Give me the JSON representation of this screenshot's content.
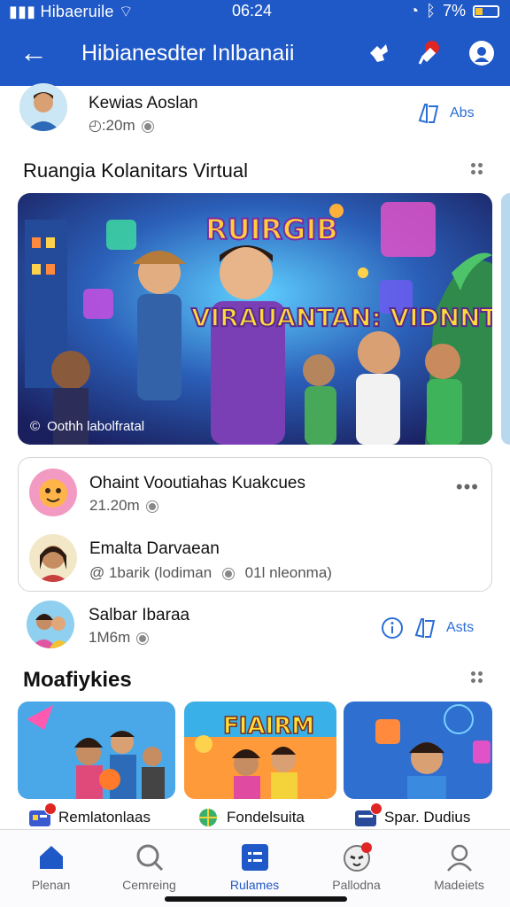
{
  "status": {
    "carrier": "Hibaeruile",
    "time": "06:24",
    "battery": "7%"
  },
  "header": {
    "title": "Hibianesdter Inlbanaii"
  },
  "colors": {
    "brand": "#1f58c7",
    "accent": "#2c6ed6",
    "badge": "#e02525"
  },
  "top_row": {
    "name": "Kewias Aoslan",
    "meta": "◴:20m",
    "action": "Abs"
  },
  "section1": {
    "title": "Ruangia Kolanitars Virtual"
  },
  "banner": {
    "headline_top": "RUIRGIB",
    "headline": "VIRAUANTAN: VIDNNTAS!",
    "caption": "Oothh labolfratal"
  },
  "card": {
    "items": [
      {
        "name": "Ohaint Vooutiahas Kuakcues",
        "meta": "21.20m"
      },
      {
        "name": "Emalta Darvaean",
        "meta_prefix": "@ 1barik (lodiman",
        "meta_suffix": "01l nleonma)"
      }
    ]
  },
  "row3": {
    "name": "Salbar Ibaraa",
    "meta": "1M6m",
    "action": "Asts"
  },
  "section2": {
    "title": "Moafiykies"
  },
  "thumbs": [
    {
      "label": "Remlatonlaas",
      "banner_text": ""
    },
    {
      "label": "Fondelsuita",
      "banner_text": "FIAIRM"
    },
    {
      "label": "Spar. Dudius",
      "banner_text": ""
    }
  ],
  "nav": [
    {
      "label": "Plenan",
      "icon": "home-icon",
      "active": false
    },
    {
      "label": "Cemreing",
      "icon": "search-icon",
      "active": false
    },
    {
      "label": "Rulames",
      "icon": "grid-icon",
      "active": true
    },
    {
      "label": "Pallodna",
      "icon": "alien-icon",
      "active": false
    },
    {
      "label": "Madeiets",
      "icon": "person-icon",
      "active": false
    }
  ]
}
